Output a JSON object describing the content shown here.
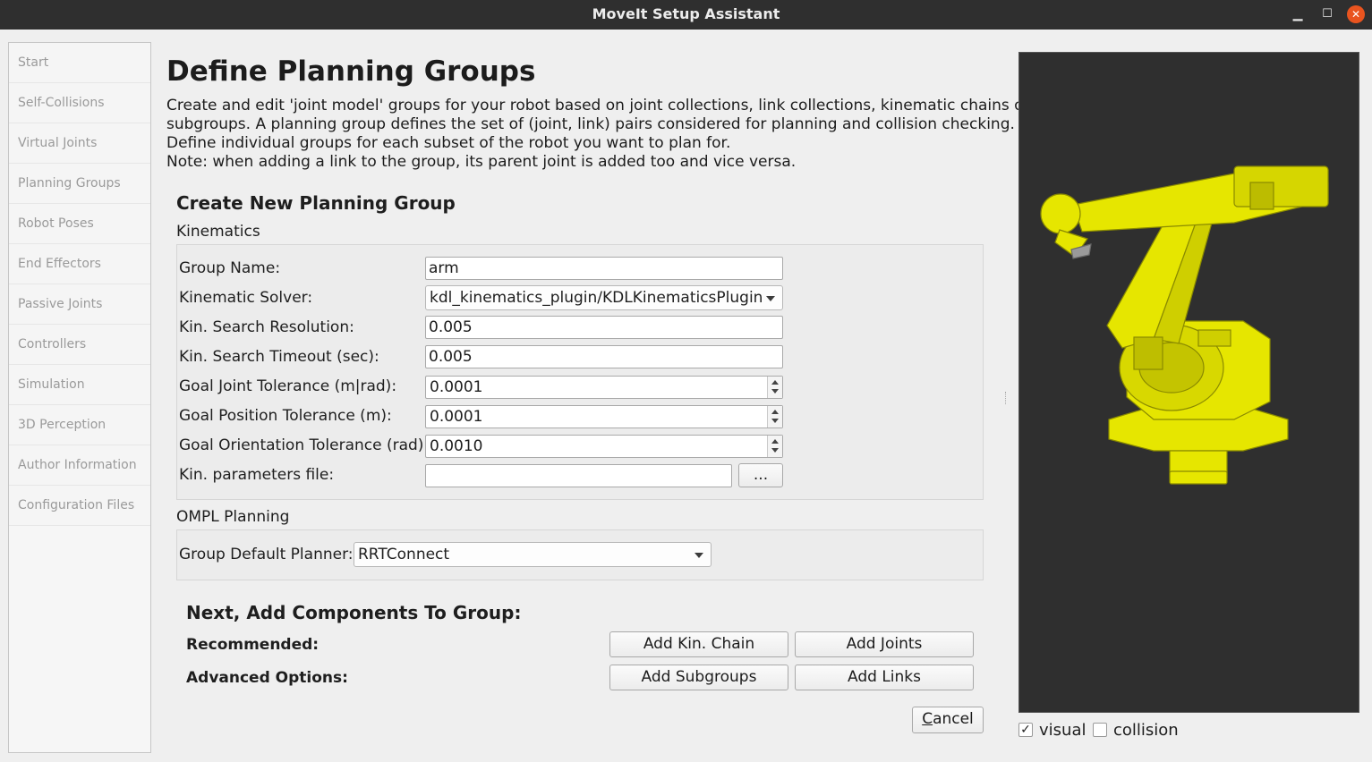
{
  "window": {
    "title": "MoveIt Setup Assistant",
    "min_glyph": "▁",
    "max_glyph": "☐",
    "close_glyph": "✕"
  },
  "sidebar": {
    "items": [
      {
        "label": "Start"
      },
      {
        "label": "Self-Collisions"
      },
      {
        "label": "Virtual Joints"
      },
      {
        "label": "Planning Groups"
      },
      {
        "label": "Robot Poses"
      },
      {
        "label": "End Effectors"
      },
      {
        "label": "Passive Joints"
      },
      {
        "label": "Controllers"
      },
      {
        "label": "Simulation"
      },
      {
        "label": "3D Perception"
      },
      {
        "label": "Author Information"
      },
      {
        "label": "Configuration Files"
      }
    ]
  },
  "page": {
    "title": "Define Planning Groups",
    "description": [
      "Create and edit 'joint model' groups for your robot based on joint collections, link collections, kinematic chains or",
      "subgroups. A planning group defines the set of (joint, link) pairs considered for planning and collision checking.",
      "Define individual groups for each subset of the robot you want to plan for.",
      "Note: when adding a link to the group, its parent joint is added too and vice versa."
    ]
  },
  "form": {
    "section_title": "Create New Planning Group",
    "kinematics_title": "Kinematics",
    "group_name": {
      "label": "Group Name:",
      "value": "arm"
    },
    "solver": {
      "label": "Kinematic Solver:",
      "value": "kdl_kinematics_plugin/KDLKinematicsPlugin"
    },
    "search_resolution": {
      "label": "Kin. Search Resolution:",
      "value": "0.005"
    },
    "search_timeout": {
      "label": "Kin. Search Timeout (sec):",
      "value": "0.005"
    },
    "joint_tolerance": {
      "label": "Goal Joint Tolerance (m|rad):",
      "value": "0.0001"
    },
    "position_tolerance": {
      "label": "Goal Position Tolerance (m):",
      "value": "0.0001"
    },
    "orientation_tolerance": {
      "label": "Goal Orientation Tolerance (rad):",
      "value": "0.0010"
    },
    "params_file": {
      "label": "Kin. parameters file:",
      "value": "",
      "browse_label": "..."
    },
    "ompl_title": "OMPL Planning",
    "planner": {
      "label": "Group Default Planner:",
      "value": "RRTConnect"
    }
  },
  "components": {
    "title": "Next, Add Components To Group:",
    "recommended_label": "Recommended:",
    "advanced_label": "Advanced Options:",
    "add_chain": "Add Kin. Chain",
    "add_joints": "Add Joints",
    "add_subgroups": "Add Subgroups",
    "add_links": "Add Links"
  },
  "cancel": {
    "label_rest": "ancel",
    "mnemonic": "C"
  },
  "viewer": {
    "visual": {
      "label": "visual",
      "checked": true,
      "mark": "✓"
    },
    "collision": {
      "label": "collision",
      "checked": false,
      "mark": ""
    },
    "robot_color": "#e6e600",
    "background_color": "#2f2f2f"
  }
}
